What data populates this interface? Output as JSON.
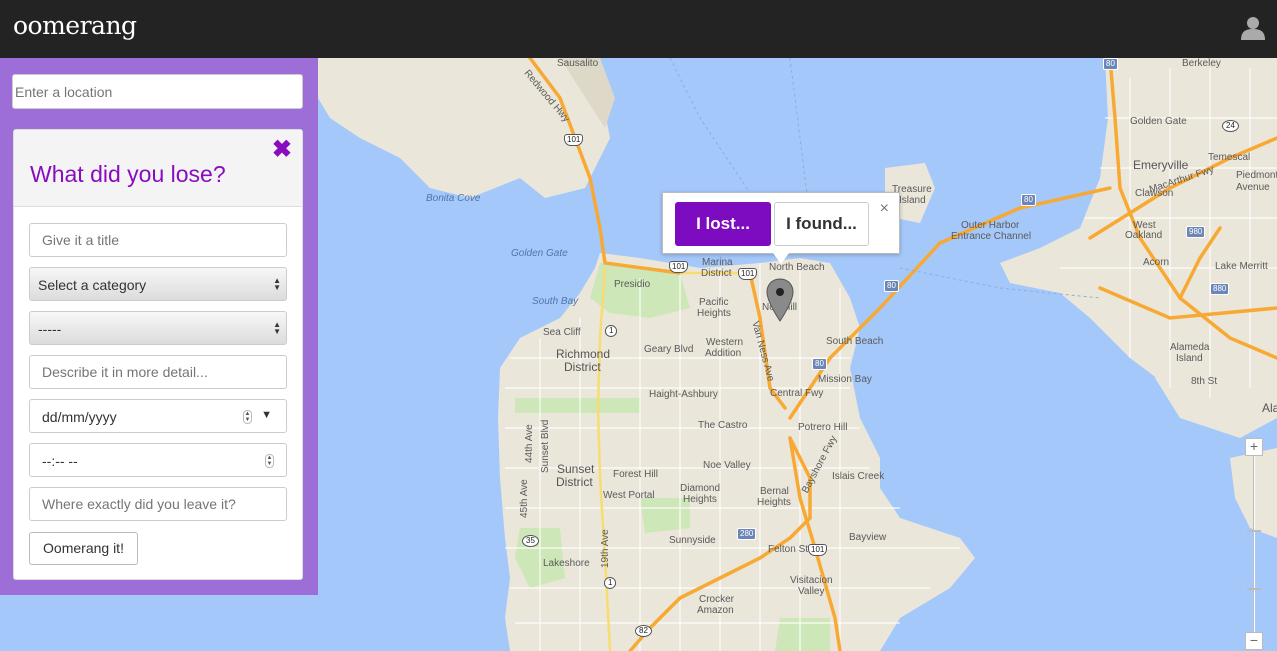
{
  "app": {
    "brand": "oomerang"
  },
  "header": {
    "user_icon": "user-icon"
  },
  "location_search": {
    "placeholder": "Enter a location"
  },
  "form": {
    "title": "What did you lose?",
    "close_glyph": "✖",
    "title_placeholder": "Give it a title",
    "category_value": "Select a category",
    "subcategory_value": "-----",
    "description_placeholder": "Describe it in more detail...",
    "date_value": "dd/mm/yyyy",
    "time_value": "--:-- --",
    "where_placeholder": "Where exactly did you leave it?",
    "submit_label": "Oomerang it!"
  },
  "popup": {
    "lost_label": "I lost...",
    "found_label": "I found...",
    "close_glyph": "×"
  },
  "map": {
    "zoom_in": "+",
    "zoom_out": "−",
    "labels": {
      "sausalito": "Sausalito",
      "berkeley": "Berkeley",
      "golden_gate_n": "Golden Gate",
      "temescal": "Temescal",
      "emeryville": "Emeryville",
      "piedmont": "Piedmont",
      "avenue": "Avenue",
      "clawson": "Clawson",
      "bonita_cove": "Bonita Cove",
      "treasure_island": "Treasure",
      "treasure_island_2": "Island",
      "outer_harbor": "Outer Harbor",
      "entrance_channel": "Entrance Channel",
      "west_oakland": "West",
      "west_oakland_2": "Oakland",
      "golden_gate_water": "Golden Gate",
      "marina_district": "Marina",
      "marina_district_2": "District",
      "north_beach": "North Beach",
      "nob_hill": "Nob Hill",
      "acorn": "Acorn",
      "lake_merritt": "Lake Merritt",
      "presidio": "Presidio",
      "south_bay": "South Bay",
      "pacific_heights": "Pacific",
      "pacific_heights_2": "Heights",
      "sea_cliff": "Sea Cliff",
      "richmond_district": "Richmond",
      "richmond_district_2": "District",
      "geary_blvd": "Geary Blvd",
      "western_addition": "Western",
      "western_addition_2": "Addition",
      "south_beach": "South Beach",
      "alameda_island": "Alameda",
      "alameda_island_2": "Island",
      "mission_bay": "Mission Bay",
      "haight_ashbury": "Haight-Ashbury",
      "central_fwy": "Central Fwy",
      "the_castro": "The Castro",
      "potrero_hill": "Potrero Hill",
      "noe_valley": "Noe Valley",
      "sunset_district": "Sunset",
      "sunset_district_2": "District",
      "forest_hill": "Forest Hill",
      "islais_creek": "Islais Creek",
      "west_portal": "West Portal",
      "diamond_heights": "Diamond",
      "diamond_heights_2": "Heights",
      "bernal_heights": "Bernal",
      "bernal_heights_2": "Heights",
      "sunnyside": "Sunnyside",
      "felton_st": "Felton St",
      "bayview": "Bayview",
      "lakeshore": "Lakeshore",
      "visitacion_valley": "Visitacion",
      "visitacion_valley_2": "Valley",
      "crocker_amazon": "Crocker",
      "crocker_amazon_2": "Amazon",
      "sunset_blvd": "Sunset Blvd",
      "ave_44": "44th Ave",
      "ave_45": "45th Ave",
      "ave_19": "19th Ave",
      "van_ness": "Van Ness Ave",
      "bayshore_fwy": "Bayshore Fwy",
      "macarthur_fwy": "MacArthur Fwy",
      "redwood_hwy": "Redwood Hwy",
      "ala": "Ala",
      "sth_st": "8th St"
    },
    "shields": {
      "s80a": "80",
      "s80b": "80",
      "s80c": "80",
      "s80d": "80",
      "s24": "24",
      "s980": "980",
      "s880": "880",
      "s101a": "101",
      "s101b": "101",
      "s101c": "101",
      "s101d": "101",
      "s1a": "1",
      "s1b": "1",
      "s280": "280",
      "s35": "35",
      "s82": "82"
    }
  }
}
